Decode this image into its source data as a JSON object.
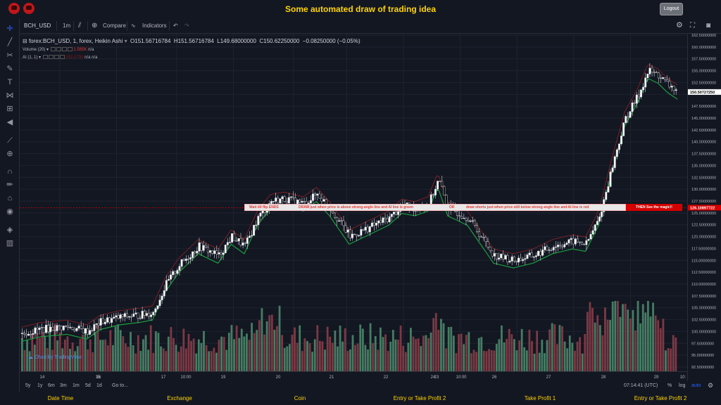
{
  "banner": {
    "title": "Some automated draw of trading idea",
    "logout_label": "Logout"
  },
  "toolbar": {
    "symbol": "BCH_USD",
    "interval": "1m",
    "compare_label": "Compare",
    "indicators_label": "Indicators"
  },
  "legend": {
    "main": "forex:BCH_USD, 1, forex, Heikin Ashi",
    "open": "O151.56716784",
    "high": "H151.56716784",
    "low": "L149.68000000",
    "close": "C150.62250000",
    "change": "−0.08250000 (−0.05%)",
    "volume_label": "Volume (20)",
    "volume_value": "1.585K",
    "volume_na": "n/a",
    "ai_label": "AI (1, 1)",
    "ai_value": "152.1700",
    "ai_na1": "n/a",
    "ai_na2": "n/a"
  },
  "price_axis": {
    "ticks": [
      "162.50000000",
      "160.00000000",
      "157.50000000",
      "155.00000000",
      "152.50000000",
      "147.50000000",
      "145.00000000",
      "142.50000000",
      "140.00000000",
      "137.50000000",
      "135.00000000",
      "132.50000000",
      "130.00000000",
      "127.50000000",
      "125.00000000",
      "122.50000000",
      "120.00000000",
      "117.50000000",
      "115.00000000",
      "112.50000000",
      "110.00000000",
      "107.50000000",
      "105.00000000",
      "102.50000000",
      "100.00000000",
      "97.50000000",
      "95.00000000",
      "92.50000000"
    ],
    "current_price": "150.50727250",
    "line_price": "126.10897722"
  },
  "time_axis": {
    "labels": [
      "14",
      "15",
      "16",
      "17",
      "10:00",
      "19",
      "20",
      "21",
      "22",
      "23",
      "24",
      "10:00",
      "26",
      "27",
      "28",
      "29",
      "10:"
    ]
  },
  "annotation": {
    "part1": "Wait till flip ENDS",
    "part2": "DRAW just when price is above strong angle line and AI line is green",
    "part3": "OR",
    "part4": "draw shorts just when price still below strong angle line and AI line is red",
    "magic": "THEN See the magic!!"
  },
  "watermark": "Chart by TradingView",
  "bottom_bar": {
    "ranges": [
      "5y",
      "1y",
      "6m",
      "3m",
      "1m",
      "5d",
      "1d"
    ],
    "goto": "Go to...",
    "clock": "07:14:41 (UTC)",
    "percent": "%",
    "log": "log",
    "auto": "auto"
  },
  "footer": {
    "columns": [
      "Date Time",
      "Exchange",
      "Coin",
      "Entry or Take Profit 2",
      "Take Profit 1",
      "Entry or Take Profit 2"
    ]
  },
  "colors": {
    "accent_yellow": "#ffd400",
    "candle_up": "#ffffff",
    "candle_down": "#000000",
    "ai_green": "#1b9e3e",
    "ai_red": "#c62828",
    "vol_green": "#4f8f6f",
    "vol_red": "#8f3f4a"
  },
  "chart_data": {
    "type": "candlestick",
    "ylim": [
      92.5,
      162.5
    ],
    "x_labels": [
      "14",
      "15",
      "16",
      "17",
      "10:00",
      "19",
      "20",
      "21",
      "22",
      "23",
      "24",
      "10:00",
      "26",
      "27",
      "28",
      "29"
    ],
    "price_path": [
      [
        0.0,
        99.5
      ],
      [
        0.03,
        100.5
      ],
      [
        0.07,
        101.0
      ],
      [
        0.1,
        100.0
      ],
      [
        0.12,
        102.0
      ],
      [
        0.15,
        103.0
      ],
      [
        0.18,
        103.5
      ],
      [
        0.2,
        104.0
      ],
      [
        0.22,
        110.0
      ],
      [
        0.24,
        114.0
      ],
      [
        0.27,
        118.0
      ],
      [
        0.3,
        116.0
      ],
      [
        0.32,
        120.0
      ],
      [
        0.34,
        118.0
      ],
      [
        0.36,
        124.0
      ],
      [
        0.38,
        127.5
      ],
      [
        0.4,
        128.0
      ],
      [
        0.43,
        127.0
      ],
      [
        0.45,
        129.0
      ],
      [
        0.47,
        126.0
      ],
      [
        0.5,
        120.0
      ],
      [
        0.53,
        122.0
      ],
      [
        0.56,
        124.0
      ],
      [
        0.58,
        126.5
      ],
      [
        0.6,
        126.0
      ],
      [
        0.62,
        127.0
      ],
      [
        0.635,
        132.0
      ],
      [
        0.65,
        126.0
      ],
      [
        0.68,
        124.0
      ],
      [
        0.7,
        120.0
      ],
      [
        0.72,
        116.0
      ],
      [
        0.75,
        115.0
      ],
      [
        0.78,
        116.0
      ],
      [
        0.81,
        118.0
      ],
      [
        0.84,
        119.0
      ],
      [
        0.86,
        118.5
      ],
      [
        0.88,
        124.0
      ],
      [
        0.9,
        135.0
      ],
      [
        0.92,
        145.0
      ],
      [
        0.94,
        150.0
      ],
      [
        0.955,
        155.0
      ],
      [
        0.97,
        154.0
      ],
      [
        0.985,
        152.0
      ],
      [
        1.0,
        150.6
      ]
    ],
    "volume_bars": 260
  }
}
